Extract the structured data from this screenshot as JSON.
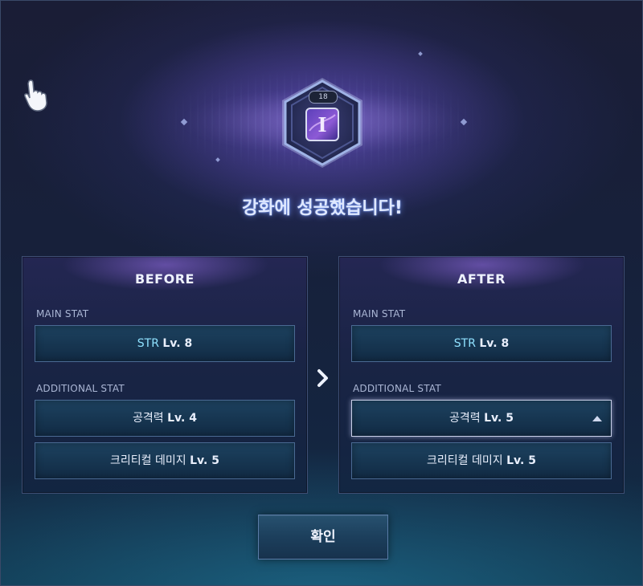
{
  "emblem": {
    "level": "18",
    "rune": "I",
    "icon": "hexagon-rune-icon"
  },
  "title": "강화에 성공했습니다!",
  "before": {
    "header": "BEFORE",
    "main_label": "MAIN STAT",
    "main_stat": {
      "name": "STR",
      "level": "Lv. 8"
    },
    "additional_label": "ADDITIONAL STAT",
    "additional": [
      {
        "name": "공격력",
        "level": "Lv. 4"
      },
      {
        "name": "크리티컬 데미지",
        "level": "Lv. 5"
      }
    ]
  },
  "after": {
    "header": "AFTER",
    "main_label": "MAIN STAT",
    "main_stat": {
      "name": "STR",
      "level": "Lv. 8"
    },
    "additional_label": "ADDITIONAL STAT",
    "additional": [
      {
        "name": "공격력",
        "level": "Lv. 5",
        "upgraded": true
      },
      {
        "name": "크리티컬 데미지",
        "level": "Lv. 5"
      }
    ]
  },
  "confirm_label": "확인",
  "colors": {
    "stat_key": "#8fe1ff",
    "title_glow": "#7fa0ff",
    "panel_border": "#3f4f74"
  },
  "icons": {
    "cursor": "hand-cursor-icon",
    "arrow": "chevron-right-icon",
    "upgrade": "triangle-up-icon"
  }
}
